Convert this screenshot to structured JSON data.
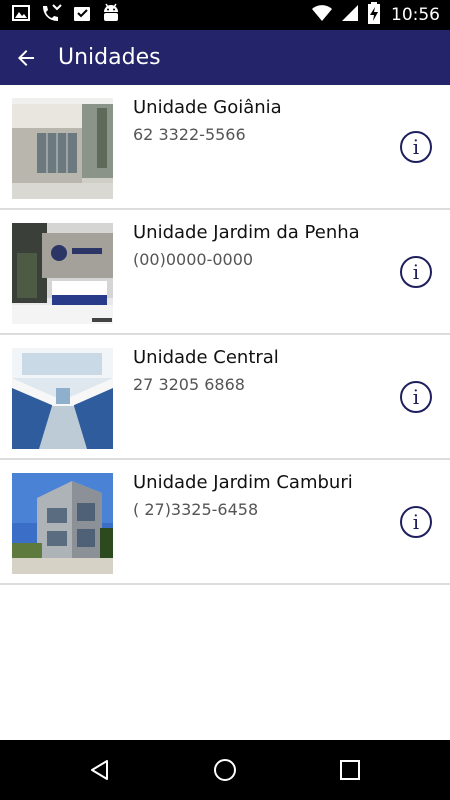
{
  "status_bar": {
    "time": "10:56",
    "left_icons": [
      "image-icon",
      "phone-missed-icon",
      "inbox-icon",
      "android-icon"
    ],
    "right_icons": [
      "wifi-icon",
      "signal-icon",
      "battery-charging-icon"
    ]
  },
  "app_bar": {
    "title": "Unidades",
    "background": "#232469"
  },
  "units": [
    {
      "name": "Unidade Goiânia",
      "phone": "62 3322-5566"
    },
    {
      "name": "Unidade Jardim da Penha",
      "phone": "(00)0000-0000"
    },
    {
      "name": "Unidade Central",
      "phone": "27 3205 6868"
    },
    {
      "name": "Unidade Jardim Camburi",
      "phone": "( 27)3325-6458"
    }
  ],
  "nav_bar": {
    "buttons": [
      "back-icon",
      "home-icon",
      "recents-icon"
    ]
  }
}
